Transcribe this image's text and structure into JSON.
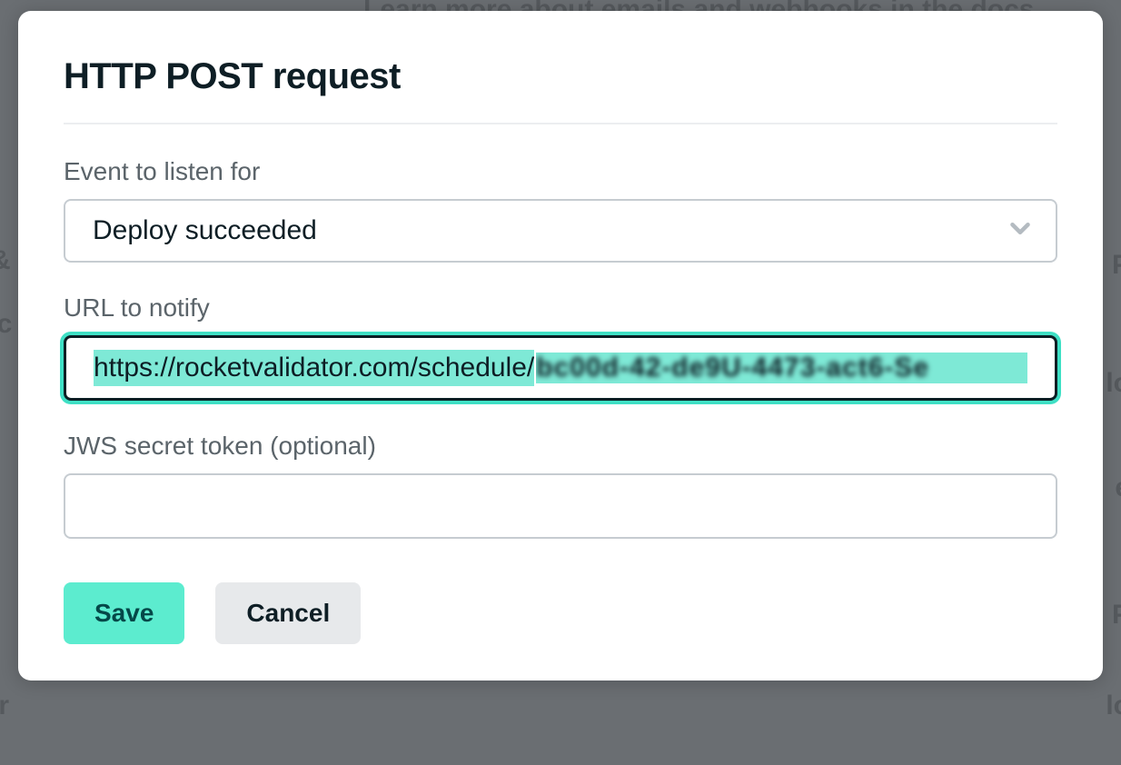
{
  "modal": {
    "title": "HTTP POST request",
    "fields": {
      "event": {
        "label": "Event to listen for",
        "value": "Deploy succeeded"
      },
      "url": {
        "label": "URL to notify",
        "value_visible": "https://rocketvalidator.com/schedule/",
        "value_obscured": "bc00d-42-de9U-4473-act6-Se"
      },
      "secret": {
        "label": "JWS secret token (optional)",
        "value": ""
      }
    },
    "actions": {
      "save": "Save",
      "cancel": "Cancel"
    }
  },
  "colors": {
    "accent": "#5ceccf",
    "highlight": "#7ee9d6",
    "border": "#c6ccd1",
    "text_muted": "#5b646a"
  }
}
